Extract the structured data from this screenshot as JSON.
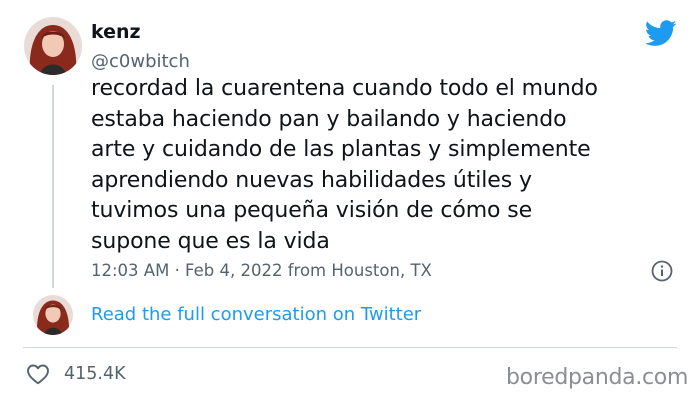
{
  "tweet": {
    "display_name": "kenz",
    "handle": "@c0wbitch",
    "text_lines": [
      "recordad la cuarentena cuando todo el mundo",
      "estaba haciendo pan y bailando y haciendo",
      "arte y cuidando de las plantas y simplemente",
      "aprendiendo nuevas habilidades útiles y",
      "tuvimos una pequeña visión de cómo se",
      "supone que es la vida"
    ],
    "meta": "12:03 AM · Feb 4, 2022 from Houston, TX",
    "read_link": "Read the full conversation on Twitter",
    "like_count": "415.4K"
  },
  "watermark": "boredpanda.com",
  "icons": {
    "brand": "twitter-bird-icon",
    "info": "info-icon",
    "like": "heart-icon"
  },
  "colors": {
    "brand_blue": "#1d9bf0",
    "secondary_text": "#536471",
    "primary_text": "#0f1419",
    "divider": "#cfd9de"
  }
}
